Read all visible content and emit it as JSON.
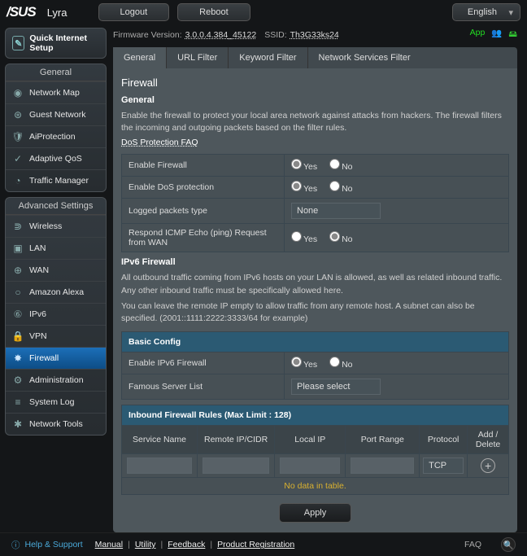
{
  "top": {
    "brand": "/SUS",
    "product": "Lyra",
    "logout": "Logout",
    "reboot": "Reboot",
    "lang": "English"
  },
  "info": {
    "fw_label": "Firmware Version:",
    "fw_value": "3.0.0.4.384_45122",
    "ssid_label": "SSID:",
    "ssid_value": "Th3G33ks24",
    "app": "App"
  },
  "sidebar": {
    "quick": "Quick Internet Setup",
    "hdr1": "General",
    "hdr2": "Advanced Settings",
    "general": [
      {
        "label": "Network Map",
        "icon": "◉"
      },
      {
        "label": "Guest Network",
        "icon": "⊛"
      },
      {
        "label": "AiProtection",
        "icon": "🛡"
      },
      {
        "label": "Adaptive QoS",
        "icon": "✓"
      },
      {
        "label": "Traffic Manager",
        "icon": "◔"
      }
    ],
    "advanced": [
      {
        "label": "Wireless",
        "icon": "⋑"
      },
      {
        "label": "LAN",
        "icon": "▣"
      },
      {
        "label": "WAN",
        "icon": "⊕"
      },
      {
        "label": "Amazon Alexa",
        "icon": "○"
      },
      {
        "label": "IPv6",
        "icon": "⑥"
      },
      {
        "label": "VPN",
        "icon": "🔒"
      },
      {
        "label": "Firewall",
        "icon": "✸"
      },
      {
        "label": "Administration",
        "icon": "⚙"
      },
      {
        "label": "System Log",
        "icon": "≡"
      },
      {
        "label": "Network Tools",
        "icon": "✱"
      }
    ]
  },
  "tabs": [
    "General",
    "URL Filter",
    "Keyword Filter",
    "Network Services Filter"
  ],
  "panel": {
    "title": "Firewall",
    "sec1": "General",
    "desc1": "Enable the firewall to protect your local area network against attacks from hackers. The firewall filters the incoming and outgoing packets based on the filter rules.",
    "faq": "DoS Protection FAQ",
    "rows": {
      "enable_fw": "Enable Firewall",
      "enable_dos": "Enable DoS protection",
      "logged": "Logged packets type",
      "logged_val": "None",
      "icmp": "Respond ICMP Echo (ping) Request from WAN"
    },
    "sec2": "IPv6 Firewall",
    "desc2": "All outbound traffic coming from IPv6 hosts on your LAN is allowed, as well as related inbound traffic. Any other inbound traffic must be specifically allowed here.",
    "desc3": "You can leave the remote IP empty to allow traffic from any remote host. A subnet can also be specified. (2001::1111:2222:3333/64 for example)",
    "basic_hdr": "Basic Config",
    "rows6": {
      "enable_v6": "Enable IPv6 Firewall",
      "famous": "Famous Server List",
      "famous_val": "Please select"
    },
    "rules_hdr": "Inbound Firewall Rules (Max Limit : 128)",
    "cols": [
      "Service Name",
      "Remote IP/CIDR",
      "Local IP",
      "Port Range",
      "Protocol",
      "Add / Delete"
    ],
    "proto_val": "TCP",
    "nodata": "No data in table.",
    "apply": "Apply",
    "yes": "Yes",
    "no": "No"
  },
  "footer": {
    "help": "Help & Support",
    "links": [
      "Manual",
      "Utility",
      "Feedback",
      "Product Registration"
    ],
    "faq": "FAQ"
  }
}
